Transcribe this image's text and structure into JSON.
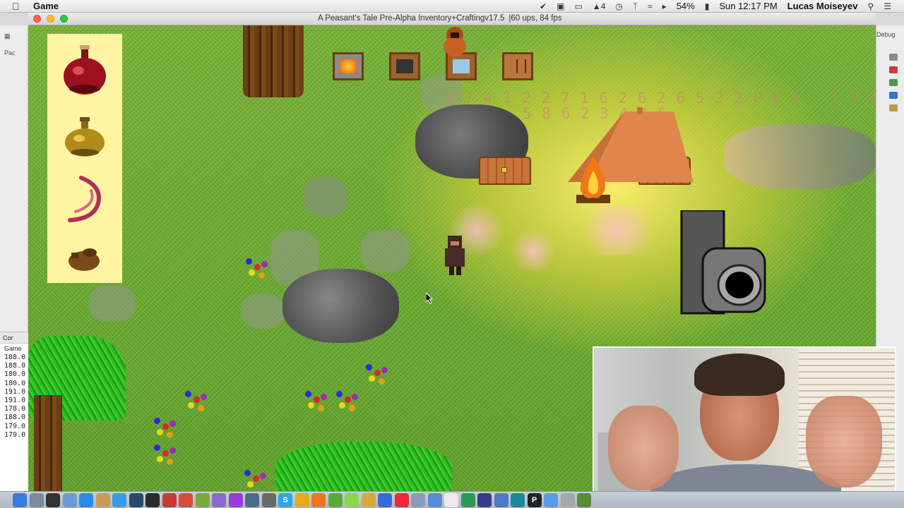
{
  "menubar": {
    "app_name": "Game",
    "battery": "54%",
    "clock": "Sun 12:17 PM",
    "user": "Lucas Moiseyev",
    "adobe_count": "4"
  },
  "window": {
    "title": "A Peasant's Tale Pre-Alpha Inventory+Craftingv17.5",
    "stats": "|60 ups, 84 fps"
  },
  "ide": {
    "left_tab": "Pac",
    "console_tab": "Cor",
    "console_subtitle": "Game",
    "console_lines": [
      "188.0",
      "188.0",
      "180.0",
      "180.0",
      "191.0",
      "191.0",
      "178.0",
      "188.0",
      "179.0",
      "179.0"
    ],
    "right_label": "Debug"
  },
  "game": {
    "inventory": [
      {
        "icon": "red-potion-icon",
        "color": "#9c1020"
      },
      {
        "icon": "yellow-potion-icon",
        "color": "#b08a1a"
      },
      {
        "icon": "worm-icon",
        "color": "#b0305a"
      },
      {
        "icon": "leather-pouch-icon",
        "color": "#7a4a18"
      }
    ],
    "crafting_stations": [
      {
        "icon": "furnace-icon",
        "color": "#e85a10"
      },
      {
        "icon": "anvil-icon",
        "color": "#333333"
      },
      {
        "icon": "glass-icon",
        "color": "#9ec8e8"
      },
      {
        "icon": "workbench-icon",
        "color": "#b8763a"
      }
    ],
    "floating_numbers_line1": "2 7 4 1 2 2  7 1 6 2 6 2 6 5 2 2 P 6 1 .  1 2 4 7",
    "floating_numbers_line2": "5 8 6 2 3 4 7 5"
  },
  "colors": {
    "grass": "#6aab2e",
    "inventory_bg": "#fff4a2",
    "menubar": "#e9e9e9"
  }
}
